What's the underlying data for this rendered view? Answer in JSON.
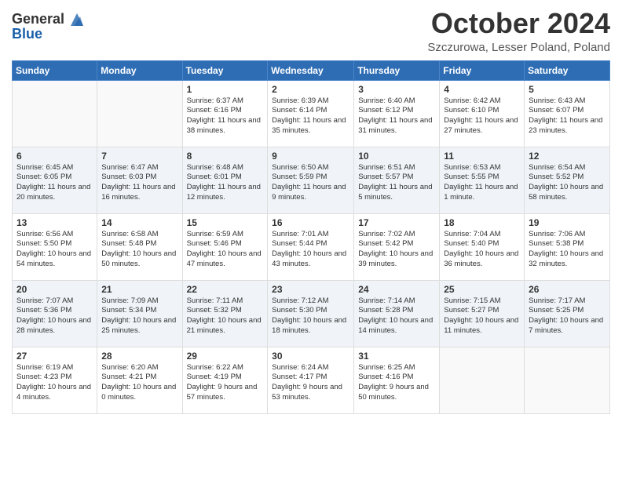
{
  "header": {
    "logo_general": "General",
    "logo_blue": "Blue",
    "title": "October 2024",
    "location": "Szczurowa, Lesser Poland, Poland"
  },
  "days_of_week": [
    "Sunday",
    "Monday",
    "Tuesday",
    "Wednesday",
    "Thursday",
    "Friday",
    "Saturday"
  ],
  "weeks": [
    [
      {
        "day": "",
        "detail": ""
      },
      {
        "day": "",
        "detail": ""
      },
      {
        "day": "1",
        "detail": "Sunrise: 6:37 AM\nSunset: 6:16 PM\nDaylight: 11 hours and 38 minutes."
      },
      {
        "day": "2",
        "detail": "Sunrise: 6:39 AM\nSunset: 6:14 PM\nDaylight: 11 hours and 35 minutes."
      },
      {
        "day": "3",
        "detail": "Sunrise: 6:40 AM\nSunset: 6:12 PM\nDaylight: 11 hours and 31 minutes."
      },
      {
        "day": "4",
        "detail": "Sunrise: 6:42 AM\nSunset: 6:10 PM\nDaylight: 11 hours and 27 minutes."
      },
      {
        "day": "5",
        "detail": "Sunrise: 6:43 AM\nSunset: 6:07 PM\nDaylight: 11 hours and 23 minutes."
      }
    ],
    [
      {
        "day": "6",
        "detail": "Sunrise: 6:45 AM\nSunset: 6:05 PM\nDaylight: 11 hours and 20 minutes."
      },
      {
        "day": "7",
        "detail": "Sunrise: 6:47 AM\nSunset: 6:03 PM\nDaylight: 11 hours and 16 minutes."
      },
      {
        "day": "8",
        "detail": "Sunrise: 6:48 AM\nSunset: 6:01 PM\nDaylight: 11 hours and 12 minutes."
      },
      {
        "day": "9",
        "detail": "Sunrise: 6:50 AM\nSunset: 5:59 PM\nDaylight: 11 hours and 9 minutes."
      },
      {
        "day": "10",
        "detail": "Sunrise: 6:51 AM\nSunset: 5:57 PM\nDaylight: 11 hours and 5 minutes."
      },
      {
        "day": "11",
        "detail": "Sunrise: 6:53 AM\nSunset: 5:55 PM\nDaylight: 11 hours and 1 minute."
      },
      {
        "day": "12",
        "detail": "Sunrise: 6:54 AM\nSunset: 5:52 PM\nDaylight: 10 hours and 58 minutes."
      }
    ],
    [
      {
        "day": "13",
        "detail": "Sunrise: 6:56 AM\nSunset: 5:50 PM\nDaylight: 10 hours and 54 minutes."
      },
      {
        "day": "14",
        "detail": "Sunrise: 6:58 AM\nSunset: 5:48 PM\nDaylight: 10 hours and 50 minutes."
      },
      {
        "day": "15",
        "detail": "Sunrise: 6:59 AM\nSunset: 5:46 PM\nDaylight: 10 hours and 47 minutes."
      },
      {
        "day": "16",
        "detail": "Sunrise: 7:01 AM\nSunset: 5:44 PM\nDaylight: 10 hours and 43 minutes."
      },
      {
        "day": "17",
        "detail": "Sunrise: 7:02 AM\nSunset: 5:42 PM\nDaylight: 10 hours and 39 minutes."
      },
      {
        "day": "18",
        "detail": "Sunrise: 7:04 AM\nSunset: 5:40 PM\nDaylight: 10 hours and 36 minutes."
      },
      {
        "day": "19",
        "detail": "Sunrise: 7:06 AM\nSunset: 5:38 PM\nDaylight: 10 hours and 32 minutes."
      }
    ],
    [
      {
        "day": "20",
        "detail": "Sunrise: 7:07 AM\nSunset: 5:36 PM\nDaylight: 10 hours and 28 minutes."
      },
      {
        "day": "21",
        "detail": "Sunrise: 7:09 AM\nSunset: 5:34 PM\nDaylight: 10 hours and 25 minutes."
      },
      {
        "day": "22",
        "detail": "Sunrise: 7:11 AM\nSunset: 5:32 PM\nDaylight: 10 hours and 21 minutes."
      },
      {
        "day": "23",
        "detail": "Sunrise: 7:12 AM\nSunset: 5:30 PM\nDaylight: 10 hours and 18 minutes."
      },
      {
        "day": "24",
        "detail": "Sunrise: 7:14 AM\nSunset: 5:28 PM\nDaylight: 10 hours and 14 minutes."
      },
      {
        "day": "25",
        "detail": "Sunrise: 7:15 AM\nSunset: 5:27 PM\nDaylight: 10 hours and 11 minutes."
      },
      {
        "day": "26",
        "detail": "Sunrise: 7:17 AM\nSunset: 5:25 PM\nDaylight: 10 hours and 7 minutes."
      }
    ],
    [
      {
        "day": "27",
        "detail": "Sunrise: 6:19 AM\nSunset: 4:23 PM\nDaylight: 10 hours and 4 minutes."
      },
      {
        "day": "28",
        "detail": "Sunrise: 6:20 AM\nSunset: 4:21 PM\nDaylight: 10 hours and 0 minutes."
      },
      {
        "day": "29",
        "detail": "Sunrise: 6:22 AM\nSunset: 4:19 PM\nDaylight: 9 hours and 57 minutes."
      },
      {
        "day": "30",
        "detail": "Sunrise: 6:24 AM\nSunset: 4:17 PM\nDaylight: 9 hours and 53 minutes."
      },
      {
        "day": "31",
        "detail": "Sunrise: 6:25 AM\nSunset: 4:16 PM\nDaylight: 9 hours and 50 minutes."
      },
      {
        "day": "",
        "detail": ""
      },
      {
        "day": "",
        "detail": ""
      }
    ]
  ]
}
